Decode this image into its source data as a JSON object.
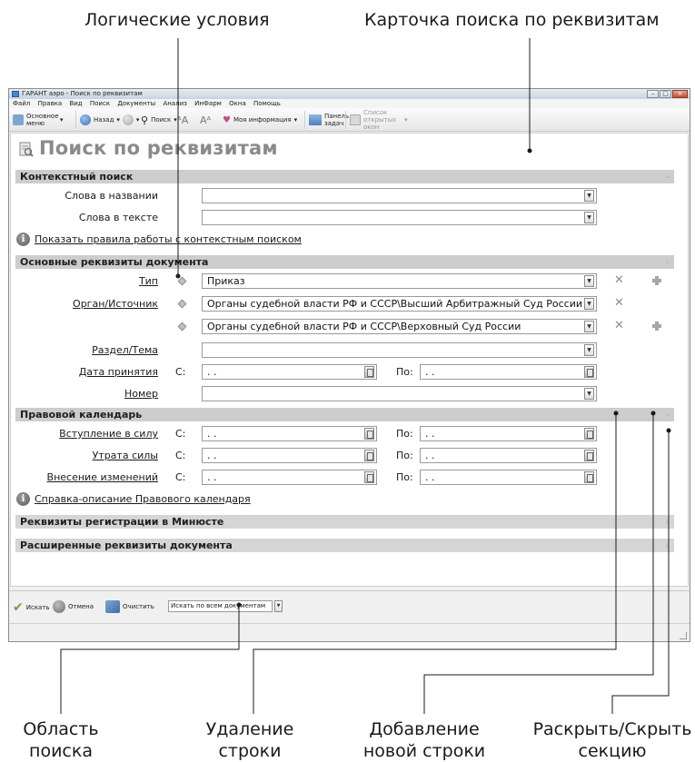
{
  "callouts": {
    "logic_conditions": "Логические условия",
    "search_card": "Карточка поиска по реквизитам",
    "search_area": "Область\nпоиска",
    "delete_row": "Удаление\nстроки",
    "add_row": "Добавление\nновой строки",
    "toggle_section": "Раскрыть/Скрыть\nсекцию"
  },
  "window": {
    "title": "ГАРАНТ аэро - Поиск по реквизитам",
    "menu": [
      "Файл",
      "Правка",
      "Вид",
      "Поиск",
      "Документы",
      "Анализ",
      "ИнФарм",
      "Окна",
      "Помощь"
    ],
    "controls": [
      "–",
      "□",
      "×"
    ]
  },
  "toolbar": {
    "main_menu": "Основное меню",
    "back": "Назад",
    "search": "Поиск",
    "my_info": "Моя информация",
    "taskbar": "Панель задач",
    "open_windows": "Список открытых окон"
  },
  "page": {
    "title": "Поиск по реквизитам"
  },
  "sections": {
    "context": {
      "title": "Контекстный поиск",
      "words_in_title": "Слова в названии",
      "words_in_text": "Слова в тексте",
      "help_link": "Показать правила работы с контекстным поиском"
    },
    "basic": {
      "title": "Основные реквизиты документа",
      "type_label": "Тип",
      "type_value": "Приказ",
      "organ_label": "Орган/Источник",
      "organ_value_1": "Органы судебной власти РФ и СССР\\Высший Арбитражный Суд России",
      "organ_value_2": "Органы судебной власти РФ и СССР\\Верховный Суд России",
      "section_label": "Раздел/Тема",
      "date_label": "Дата принятия",
      "number_label": "Номер",
      "from": "С:",
      "to": "По:",
      "date_placeholder": ". ."
    },
    "calendar": {
      "title": "Правовой календарь",
      "entry_into_force": "Вступление в силу",
      "loss_of_force": "Утрата силы",
      "amendments": "Внесение изменений",
      "help_link": "Справка-описание Правового календаря"
    },
    "minjust": {
      "title": "Реквизиты регистрации в Минюсте"
    },
    "extended": {
      "title": "Расширенные реквизиты документа"
    }
  },
  "bottom": {
    "search": "Искать",
    "cancel": "Отмена",
    "clear": "Очистить",
    "scope": "Искать по всем документам"
  }
}
